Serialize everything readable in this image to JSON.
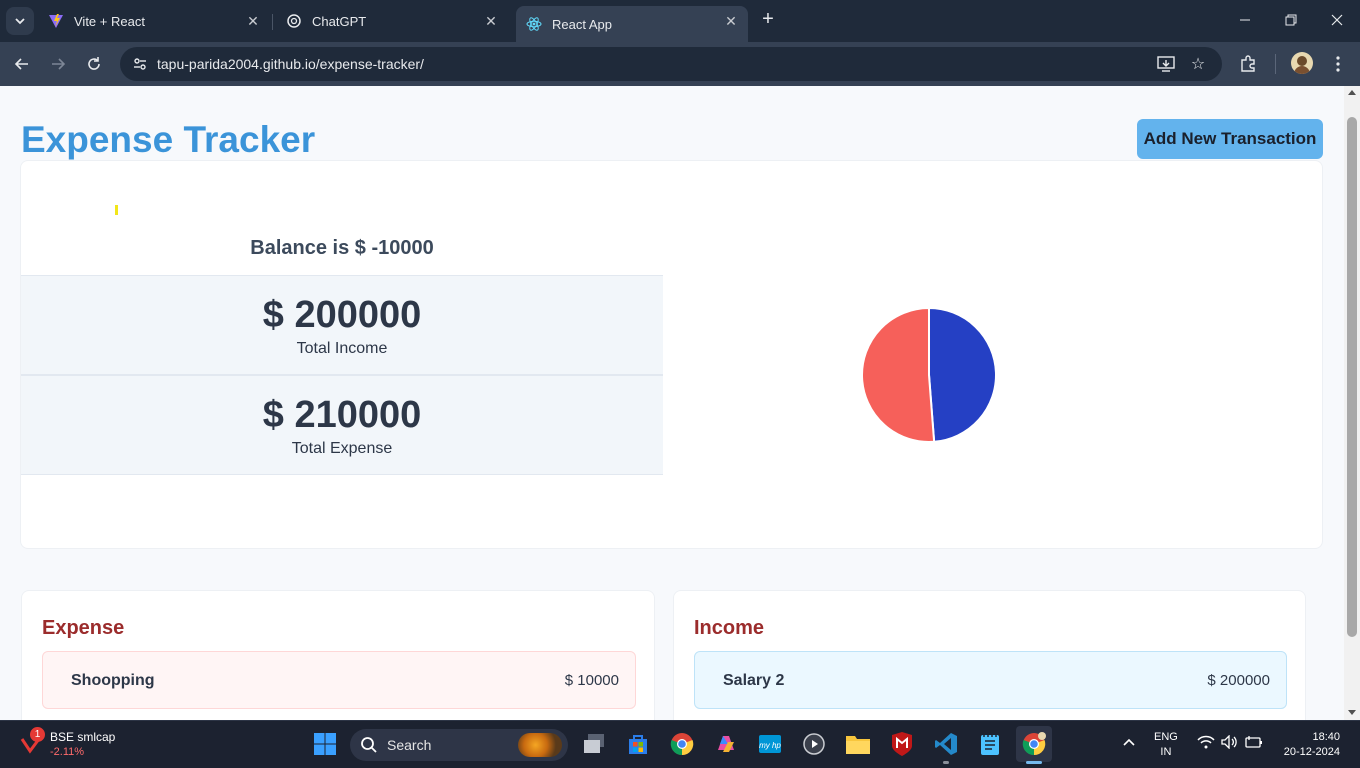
{
  "browser": {
    "tabs": [
      {
        "title": "Vite + React",
        "icon": "vite-icon",
        "active": false
      },
      {
        "title": "ChatGPT",
        "icon": "openai-icon",
        "active": false
      },
      {
        "title": "React App",
        "icon": "react-icon",
        "active": true
      }
    ],
    "url": "tapu-parida2004.github.io/expense-tracker/"
  },
  "app": {
    "title": "Expense Tracker",
    "add_button_label": "Add New Transaction",
    "balance_text": "Balance is $ -10000",
    "income": {
      "amount": "$ 200000",
      "label": "Total Income"
    },
    "expense": {
      "amount": "$ 210000",
      "label": "Total Expense"
    },
    "expense_panel": {
      "title": "Expense",
      "items": [
        {
          "name": "Shoopping",
          "amount": "$ 10000"
        }
      ]
    },
    "income_panel": {
      "title": "Income",
      "items": [
        {
          "name": "Salary 2",
          "amount": "$ 200000"
        }
      ]
    }
  },
  "chart_data": {
    "type": "pie",
    "categories": [
      "Total Income",
      "Total Expense"
    ],
    "values": [
      200000,
      210000
    ],
    "colors": [
      "#2540c4",
      "#f6605a"
    ]
  },
  "taskbar": {
    "stock_name": "BSE smlcap",
    "stock_change": "-2.11%",
    "stock_badge": "1",
    "search_placeholder": "Search",
    "lang_line1": "ENG",
    "lang_line2": "IN",
    "time": "18:40",
    "date": "20-12-2024"
  }
}
